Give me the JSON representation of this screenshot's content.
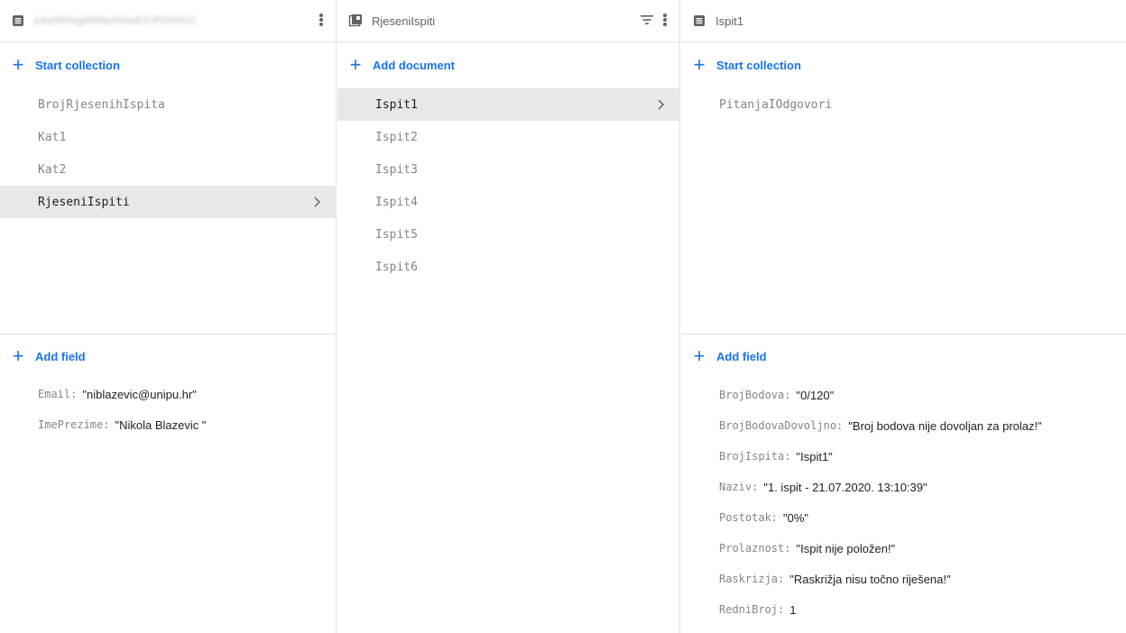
{
  "colors": {
    "accent": "#1a73e8",
    "muted": "#80868b",
    "selected_bg": "#e8e8e8",
    "divider": "#e0e0e0"
  },
  "panel1": {
    "header": {
      "title": "jnkpMOiqgNMdpXkbaEXJPDVHU2",
      "doc_icon": "document-icon",
      "menu_icon": "more-vert-icon"
    },
    "start_collection": "Start collection",
    "collections": [
      {
        "label": "BrojRjesenihIspita"
      },
      {
        "label": "Kat1"
      },
      {
        "label": "Kat2"
      },
      {
        "label": "RjeseniIspiti"
      }
    ],
    "add_field": "Add field",
    "fields": [
      {
        "key": "Email",
        "value": "\"niblazevic@unipu.hr\""
      },
      {
        "key": "ImePrezime",
        "value": "\"Nikola Blazevic \""
      }
    ]
  },
  "panel2": {
    "header": {
      "title": "RjeseniIspiti",
      "collection_icon": "collection-icon",
      "filter_icon": "filter-icon",
      "menu_icon": "more-vert-icon"
    },
    "add_document": "Add document",
    "documents": [
      {
        "label": "Ispit1"
      },
      {
        "label": "Ispit2"
      },
      {
        "label": "Ispit3"
      },
      {
        "label": "Ispit4"
      },
      {
        "label": "Ispit5"
      },
      {
        "label": "Ispit6"
      }
    ]
  },
  "panel3": {
    "header": {
      "title": "Ispit1",
      "doc_icon": "document-icon"
    },
    "start_collection": "Start collection",
    "collections": [
      {
        "label": "PitanjaIOdgovori"
      }
    ],
    "add_field": "Add field",
    "fields": [
      {
        "key": "BrojBodova",
        "value": "\"0/120\""
      },
      {
        "key": "BrojBodovaDovoljno",
        "value": "\"Broj bodova nije dovoljan za prolaz!\""
      },
      {
        "key": "BrojIspita",
        "value": "\"Ispit1\""
      },
      {
        "key": "Naziv",
        "value": "\"1. ispit - 21.07.2020. 13:10:39\""
      },
      {
        "key": "Postotak",
        "value": "\"0%\""
      },
      {
        "key": "Prolaznost",
        "value": "\"Ispit nije položen!\""
      },
      {
        "key": "Raskrizja",
        "value": "\"Raskrižja nisu točno riješena!\""
      },
      {
        "key": "RedniBroj",
        "value": "1"
      }
    ]
  }
}
